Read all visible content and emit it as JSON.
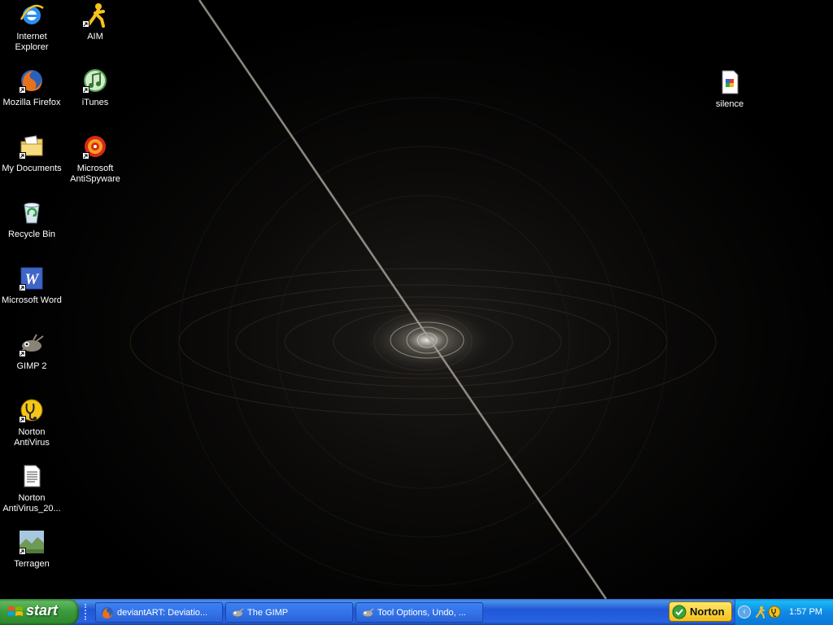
{
  "desktop_icons": [
    {
      "name": "Internet Explorer",
      "label": "Internet Explorer",
      "icon": "internet-explorer-icon"
    },
    {
      "name": "AIM",
      "label": "AIM",
      "icon": "aim-icon"
    },
    {
      "name": "Mozilla Firefox",
      "label": "Mozilla Firefox",
      "icon": "firefox-icon"
    },
    {
      "name": "iTunes",
      "label": "iTunes",
      "icon": "itunes-icon"
    },
    {
      "name": "My Documents",
      "label": "My Documents",
      "icon": "folder-icon"
    },
    {
      "name": "Microsoft AntiSpyware",
      "label": "Microsoft AntiSpyware",
      "icon": "antispyware-icon"
    },
    {
      "name": "Recycle Bin",
      "label": "Recycle Bin",
      "icon": "recycle-bin-icon"
    },
    {
      "name": "Microsoft Word",
      "label": "Microsoft Word",
      "icon": "word-icon"
    },
    {
      "name": "GIMP 2",
      "label": "GIMP 2",
      "icon": "gimp-icon"
    },
    {
      "name": "Norton AntiVirus",
      "label": "Norton AntiVirus",
      "icon": "norton-antivirus-icon"
    },
    {
      "name": "Norton AntiVirus_20...",
      "label": "Norton AntiVirus_20...",
      "icon": "text-file-icon"
    },
    {
      "name": "Terragen",
      "label": "Terragen",
      "icon": "terragen-icon"
    },
    {
      "name": "silence",
      "label": "silence",
      "icon": "image-file-icon"
    }
  ],
  "taskbar": {
    "start_label": "start",
    "tasks": [
      {
        "label": "deviantART: Deviatio...",
        "icon": "firefox-icon"
      },
      {
        "label": "The GIMP",
        "icon": "gimp-icon"
      },
      {
        "label": "Tool Options, Undo, ...",
        "icon": "gimp-icon"
      }
    ],
    "norton_label": "Norton",
    "tray_arrow": "‹",
    "clock": "1:57 PM"
  },
  "colors": {
    "taskbar_blue": "#245edb",
    "start_green": "#3a9a3a",
    "tray_blue": "#0f8ae6",
    "norton_yellow": "#f3c21a"
  }
}
